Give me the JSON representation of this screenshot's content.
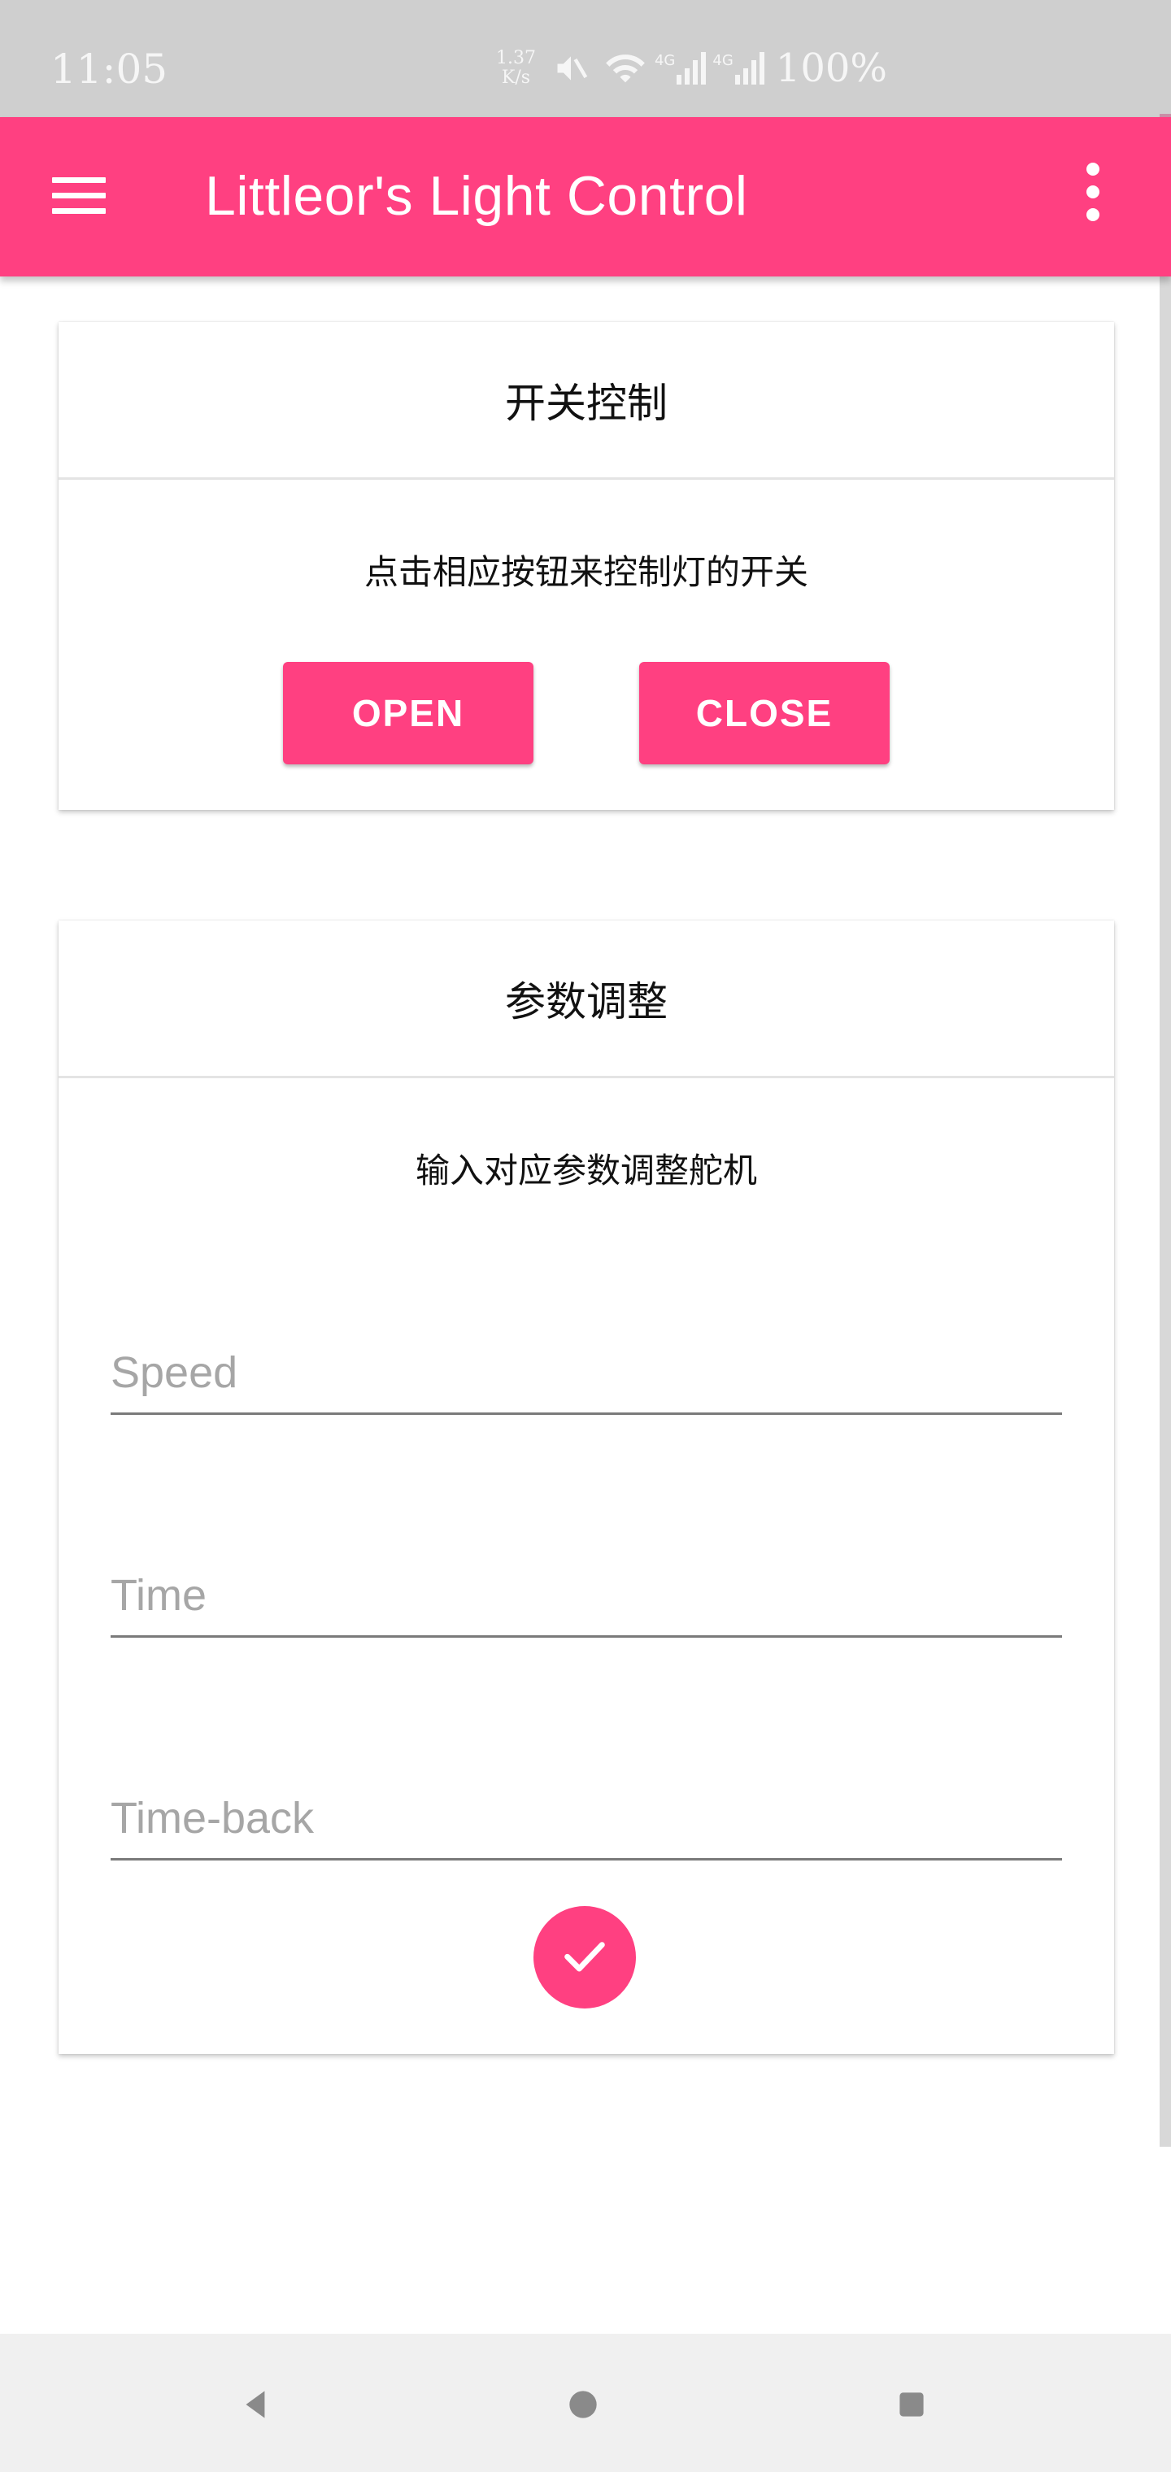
{
  "status_bar": {
    "time": "11:05",
    "net_speed_value": "1.37",
    "net_speed_unit": "K/s",
    "signal_labels": [
      "4G",
      "4G"
    ],
    "battery": "100%"
  },
  "app_bar": {
    "title": "Littleor's Light Control"
  },
  "switch_card": {
    "title": "开关控制",
    "description": "点击相应按钮来控制灯的开关",
    "open_label": "OPEN",
    "close_label": "CLOSE"
  },
  "params_card": {
    "title": "参数调整",
    "description": "输入对应参数调整舵机",
    "speed_placeholder": "Speed",
    "time_placeholder": "Time",
    "timeback_placeholder": "Time-back"
  },
  "colors": {
    "accent": "#ff4081",
    "status_bar": "#cfcfcf",
    "nav_bar": "#f0f0f0"
  },
  "icons": {
    "menu": "hamburger-menu-icon",
    "more": "more-vert-icon",
    "submit": "check-icon",
    "mute": "volume-off-icon",
    "wifi": "wifi-icon",
    "signal": "cell-signal-icon"
  }
}
